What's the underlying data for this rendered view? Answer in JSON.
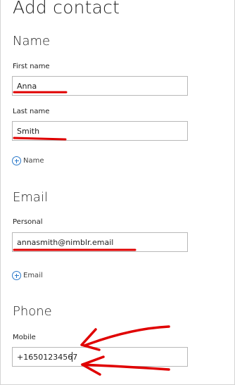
{
  "page_title": "Add contact",
  "sections": {
    "name": {
      "title": "Name",
      "first_name_label": "First name",
      "first_name_value": "Anna",
      "last_name_label": "Last name",
      "last_name_value": "Smith",
      "add_label": "Name"
    },
    "email": {
      "title": "Email",
      "personal_label": "Personal",
      "personal_value": "annasmith@nimblr.email",
      "add_label": "Email"
    },
    "phone": {
      "title": "Phone",
      "mobile_label": "Mobile",
      "mobile_value": "+16501234567"
    }
  },
  "colors": {
    "accent": "#2b79c9",
    "annotation": "#e00000"
  },
  "icons": {
    "add": "plus-circle-icon"
  }
}
